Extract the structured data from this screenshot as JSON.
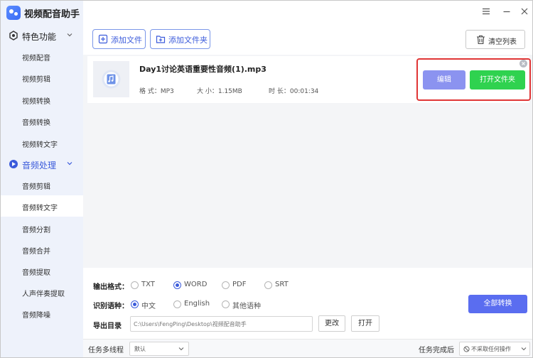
{
  "app": {
    "title": "视频配音助手"
  },
  "sidebar": {
    "groups": [
      {
        "label": "特色功能",
        "icon": "feature-icon"
      },
      {
        "label": "音频处理",
        "icon": "audio-process-icon"
      }
    ],
    "items": [
      {
        "label": "视频配音"
      },
      {
        "label": "视频剪辑"
      },
      {
        "label": "视频转换"
      },
      {
        "label": "音频转换"
      },
      {
        "label": "视频转文字"
      },
      {
        "label": "音频剪辑"
      },
      {
        "label": "音频转文字",
        "selected": true
      },
      {
        "label": "音频分割"
      },
      {
        "label": "音频合并"
      },
      {
        "label": "音频提取"
      },
      {
        "label": "人声伴奏提取"
      },
      {
        "label": "音频降噪"
      }
    ]
  },
  "toolbar": {
    "add_file": "添加文件",
    "add_folder": "添加文件夹",
    "clear_list": "清空列表"
  },
  "file": {
    "name": "Day1讨论英语重要性音频(1).mp3",
    "format": "格 式：MP3",
    "size": "大 小：1.15MB",
    "duration": "时 长：00:01:34",
    "edit_label": "编辑",
    "open_folder_label": "打开文件夹"
  },
  "settings": {
    "format_label": "输出格式：",
    "formats": [
      "TXT",
      "WORD",
      "PDF",
      "SRT"
    ],
    "selected_format": "WORD",
    "lang_label": "识别语种：",
    "langs": [
      "中文",
      "English",
      "其他语种"
    ],
    "selected_lang": "中文",
    "dir_label": "导出目录",
    "dir_value": "C:\\Users\\FengPing\\Desktop\\视频配音助手",
    "change_label": "更改",
    "open_label": "打开",
    "convert_all": "全部转换"
  },
  "footer": {
    "threads_label": "任务多线程",
    "threads_value": "默认",
    "after_label": "任务完成后",
    "after_value": "不采取任何操作"
  },
  "colors": {
    "accent": "#3b5bdb",
    "edit_button": "#8b93f0",
    "open_button": "#2fd24f",
    "convert_button": "#5a6df0",
    "highlight": "#e03535"
  }
}
